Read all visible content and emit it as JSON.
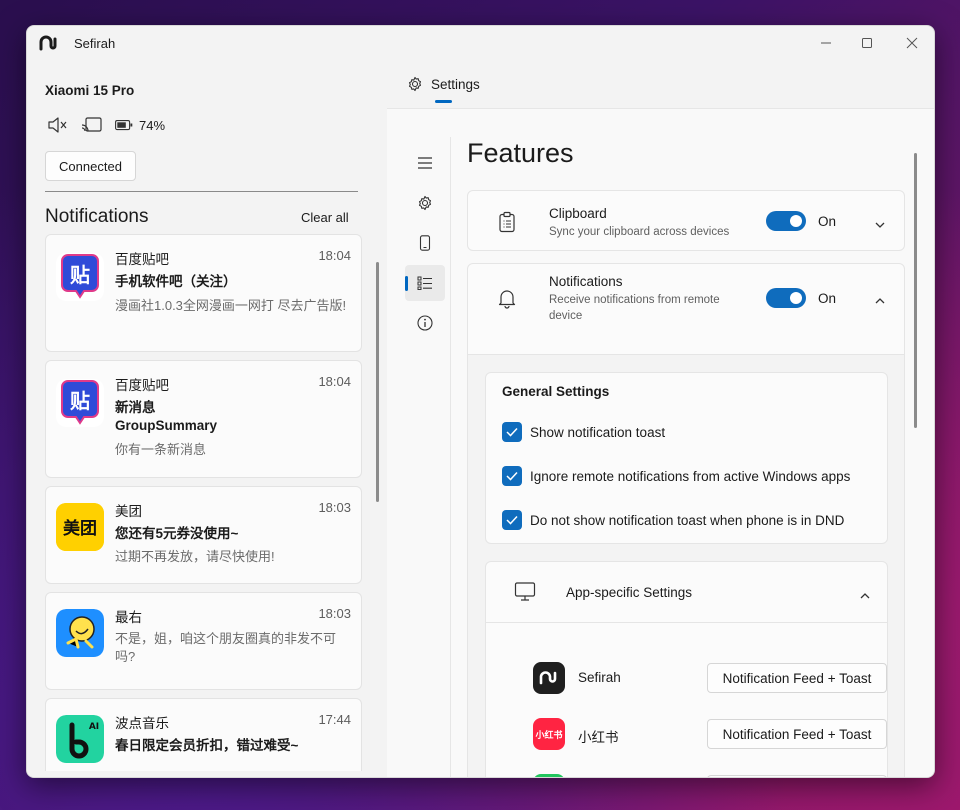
{
  "window": {
    "title": "Sefirah"
  },
  "device": {
    "name": "Xiaomi 15 Pro",
    "battery": "74%",
    "connection_button": "Connected"
  },
  "notifications_panel": {
    "header": "Notifications",
    "clear_all": "Clear all",
    "items": [
      {
        "app": "百度贴吧",
        "time": "18:04",
        "title": "手机软件吧（关注）",
        "body": "漫画社1.0.3全网漫画一网打 尽去广告版!",
        "icon_color": "#2f4bd8",
        "icon": "baidu-tieba-icon"
      },
      {
        "app": "百度贴吧",
        "time": "18:04",
        "title": "新消息",
        "subtitle": "GroupSummary",
        "body": "你有一条新消息",
        "icon_color": "#2f4bd8",
        "icon": "baidu-tieba-icon"
      },
      {
        "app": "美团",
        "time": "18:03",
        "title": "您还有5元券没使用~",
        "body": "过期不再发放，请尽快使用!",
        "icon_color": "#ffd000",
        "icon": "meituan-icon",
        "icon_text": "美团"
      },
      {
        "app": "最右",
        "time": "18:03",
        "title": "",
        "body": "不是，姐，咱这个朋友圈真的非发不可吗?",
        "icon_color": "#1e8fff",
        "icon": "zuiyou-icon"
      },
      {
        "app": "波点音乐",
        "time": "17:44",
        "title": "春日限定会员折扣，错过难受~",
        "body": "",
        "icon_color": "#22d3a0",
        "icon": "bodian-music-icon"
      }
    ]
  },
  "settings": {
    "tab_label": "Settings",
    "page_title": "Features",
    "clipboard": {
      "title": "Clipboard",
      "description": "Sync your clipboard across devices",
      "toggle_label": "On",
      "enabled": true
    },
    "notifications": {
      "title": "Notifications",
      "description": "Receive notifications from remote device",
      "toggle_label": "On",
      "enabled": true
    },
    "general": {
      "title": "General Settings",
      "options": [
        {
          "label": "Show notification toast",
          "checked": true
        },
        {
          "label": "Ignore remote notifications from active Windows apps",
          "checked": true
        },
        {
          "label": "Do not show notification toast when phone is in DND",
          "checked": true
        }
      ]
    },
    "app_specific": {
      "title": "App-specific Settings",
      "apps": [
        {
          "name": "Sefirah",
          "mode": "Notification Feed + Toast",
          "icon_color": "#1f1f1f",
          "icon": "sefirah-app-icon"
        },
        {
          "name": "小红书",
          "mode": "Notification Feed + Toast",
          "icon_color": "#ff2442",
          "icon": "xiaohongshu-icon",
          "icon_text": "小红书"
        }
      ]
    }
  },
  "colors": {
    "accent": "#0f6cbd",
    "window_bg": "#f3f3f3",
    "card_bg": "#fbfbfb"
  }
}
